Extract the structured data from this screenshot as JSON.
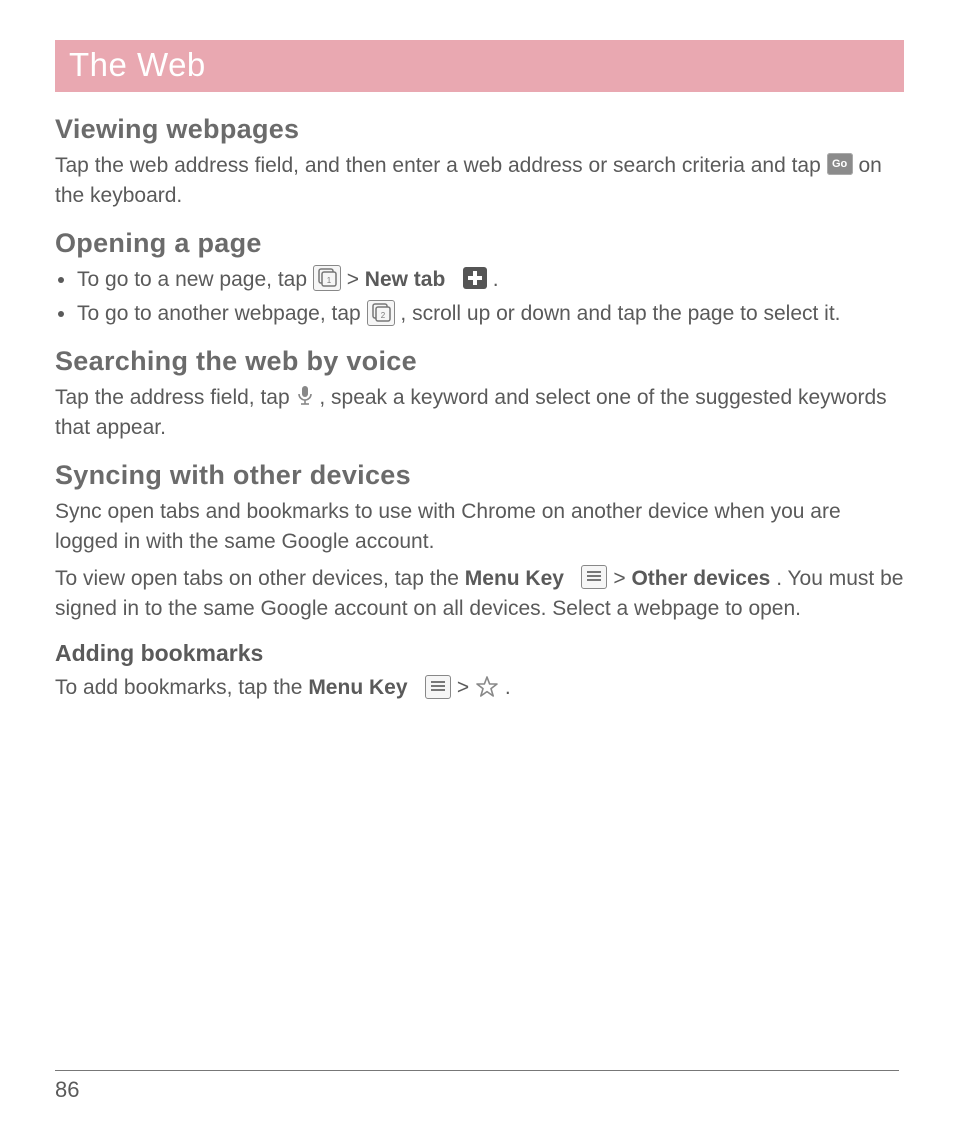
{
  "banner": "The Web",
  "pageNumber": "86",
  "sections": {
    "viewing": {
      "heading": "Viewing webpages",
      "p1a": "Tap the web address field, and then enter a web address or search criteria and tap ",
      "goLabel": "Go",
      "p1b": " on the keyboard."
    },
    "opening": {
      "heading": "Opening a page",
      "li1a": "To go to a new page, tap ",
      "gt": " > ",
      "newTab": "New tab",
      "period": ".",
      "li2a": "To go to another webpage, tap ",
      "li2b": ", scroll up or down and tap the page to select it."
    },
    "voice": {
      "heading": "Searching the web by voice",
      "p1a": "Tap the address field, tap ",
      "p1b": ", speak a keyword and select one of the suggested keywords that appear."
    },
    "sync": {
      "heading": "Syncing with other devices",
      "p1": "Sync open tabs and bookmarks to use with Chrome on another device when you are logged in with the same Google account.",
      "p2a": "To view open tabs on other devices, tap the ",
      "menuKey": "Menu Key",
      "gt": " > ",
      "otherDevices": "Other devices",
      "p2b": ". You must be signed in to the same Google account on all devices. Select a webpage to open."
    },
    "bookmarks": {
      "heading": "Adding bookmarks",
      "p1a": "To add bookmarks, tap the ",
      "menuKey": "Menu Key",
      "gt": " > ",
      "p1b": "."
    }
  }
}
